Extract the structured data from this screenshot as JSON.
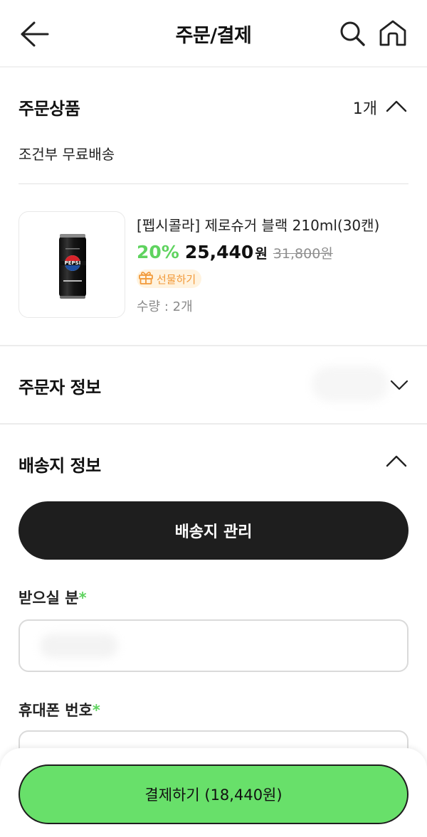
{
  "header": {
    "title": "주문/결제"
  },
  "order_products": {
    "title": "주문상품",
    "count": "1개",
    "shipping_condition": "조건부 무료배송",
    "product": {
      "name": "[펩시콜라] 제로슈거 블랙 210ml(30캔)",
      "discount": "20%",
      "price": "25,440",
      "currency": "원",
      "original_price": "31,800원",
      "gift_label": "선물하기",
      "quantity": "수량 : 2개"
    }
  },
  "orderer_info": {
    "title": "주문자 정보"
  },
  "shipping_info": {
    "title": "배송지 정보",
    "manage_button": "배송지 관리",
    "recipient_label": "받으실 분",
    "phone_label": "휴대폰 번호",
    "required_mark": "*"
  },
  "checkout": {
    "pay_button": "결제하기 (18,440원)"
  },
  "colors": {
    "accent_green": "#68e06a",
    "discount_green": "#5fd35f",
    "dark": "#1e1e1e",
    "gift_orange": "#f29a3a"
  }
}
